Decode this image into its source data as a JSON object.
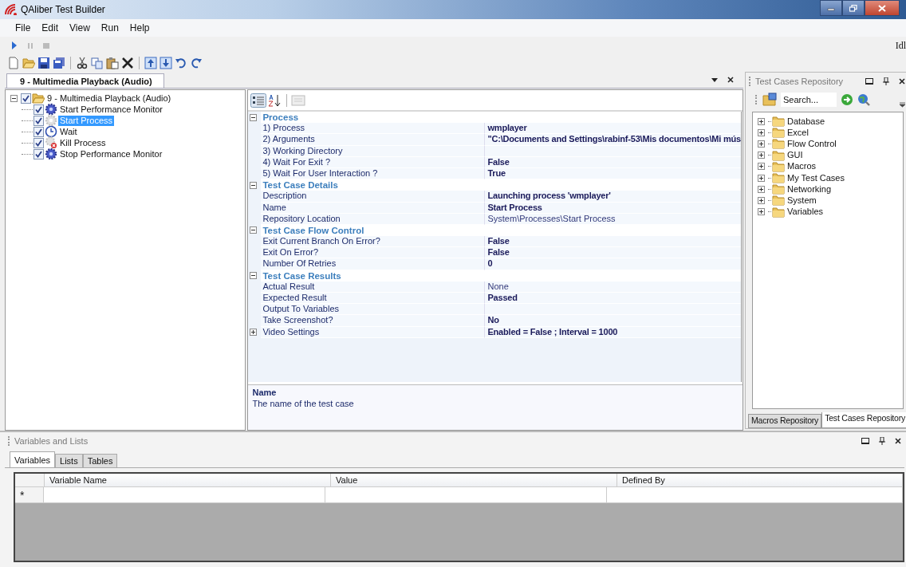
{
  "window": {
    "title": "QAliber Test Builder"
  },
  "menu": [
    "File",
    "Edit",
    "View",
    "Run",
    "Help"
  ],
  "run_status": "Idl",
  "document_tab": {
    "label": "9 - Multimedia Playback (Audio)",
    "selected": true
  },
  "tree": {
    "label": "9 - Multimedia Playback (Audio)",
    "checked": true,
    "expanded": true,
    "children": [
      {
        "label": "Start Performance Monitor",
        "kind": "gear",
        "checked": true,
        "selected": false
      },
      {
        "label": "Start Process",
        "kind": "process",
        "checked": true,
        "selected": true
      },
      {
        "label": "Wait",
        "kind": "clock",
        "checked": true,
        "selected": false
      },
      {
        "label": "Kill Process",
        "kind": "kill",
        "checked": true,
        "selected": false
      },
      {
        "label": "Stop Performance Monitor",
        "kind": "gear",
        "checked": true,
        "selected": false
      }
    ]
  },
  "property_grid": {
    "categories": [
      {
        "name": "Process",
        "expanded": true,
        "properties": [
          {
            "name": "1) Process",
            "value": "wmplayer",
            "bold": true
          },
          {
            "name": "2) Arguments",
            "value": "\"C:\\Documents and Settings\\rabinf-53\\Mis documentos\\Mi mús",
            "bold": true
          },
          {
            "name": "3) Working Directory"
          },
          {
            "name": "4) Wait For Exit ?",
            "value": "False",
            "bold": true
          },
          {
            "name": "5) Wait For User Interaction ?",
            "value": "True",
            "bold": true
          }
        ]
      },
      {
        "name": "Test Case Details",
        "expanded": true,
        "properties": [
          {
            "name": "Description",
            "value": "Launching process 'wmplayer'",
            "bold": true
          },
          {
            "name": "Name",
            "value": "Start Process",
            "bold": true
          },
          {
            "name": "Repository Location",
            "value": "System\\Processes\\Start Process",
            "bold": false
          }
        ]
      },
      {
        "name": "Test Case Flow Control",
        "expanded": true,
        "properties": [
          {
            "name": "Exit Current Branch On Error?",
            "value": "False",
            "bold": true
          },
          {
            "name": "Exit On Error?",
            "value": "False",
            "bold": true
          },
          {
            "name": "Number Of Retries",
            "value": "0",
            "bold": true
          }
        ]
      },
      {
        "name": "Test Case Results",
        "expanded": true,
        "properties": [
          {
            "name": "Actual Result",
            "value": "None",
            "bold": false
          },
          {
            "name": "Expected Result",
            "value": "Passed",
            "bold": true
          },
          {
            "name": "Output To Variables"
          },
          {
            "name": "Take Screenshot?",
            "value": "No",
            "bold": true
          },
          {
            "name": "Video Settings",
            "value": "Enabled = False ; Interval = 1000",
            "bold": true,
            "expanded": false
          }
        ]
      }
    ],
    "description": {
      "title": "Name",
      "text": "The name of the test case"
    }
  },
  "repository": {
    "title": "Test Cases Repository",
    "search_placeholder": "Search...",
    "folders": [
      {
        "label": "Database",
        "expanded": false
      },
      {
        "label": "Excel",
        "expanded": false
      },
      {
        "label": "Flow Control",
        "expanded": false
      },
      {
        "label": "GUI",
        "expanded": false
      },
      {
        "label": "Macros",
        "expanded": false
      },
      {
        "label": "My Test Cases",
        "expanded": false
      },
      {
        "label": "Networking",
        "expanded": false
      },
      {
        "label": "System",
        "expanded": false
      },
      {
        "label": "Variables",
        "expanded": false
      }
    ],
    "tabs": [
      {
        "label": "Macros Repository",
        "selected": false
      },
      {
        "label": "Test Cases Repository",
        "selected": true
      }
    ]
  },
  "variables_panel": {
    "title": "Variables and Lists",
    "tabs": [
      {
        "label": "Variables",
        "selected": true
      },
      {
        "label": "Lists",
        "selected": false
      },
      {
        "label": "Tables",
        "selected": false
      }
    ],
    "columns": [
      "Variable Name",
      "Value",
      "Defined By"
    ],
    "new_row_marker": "*"
  }
}
